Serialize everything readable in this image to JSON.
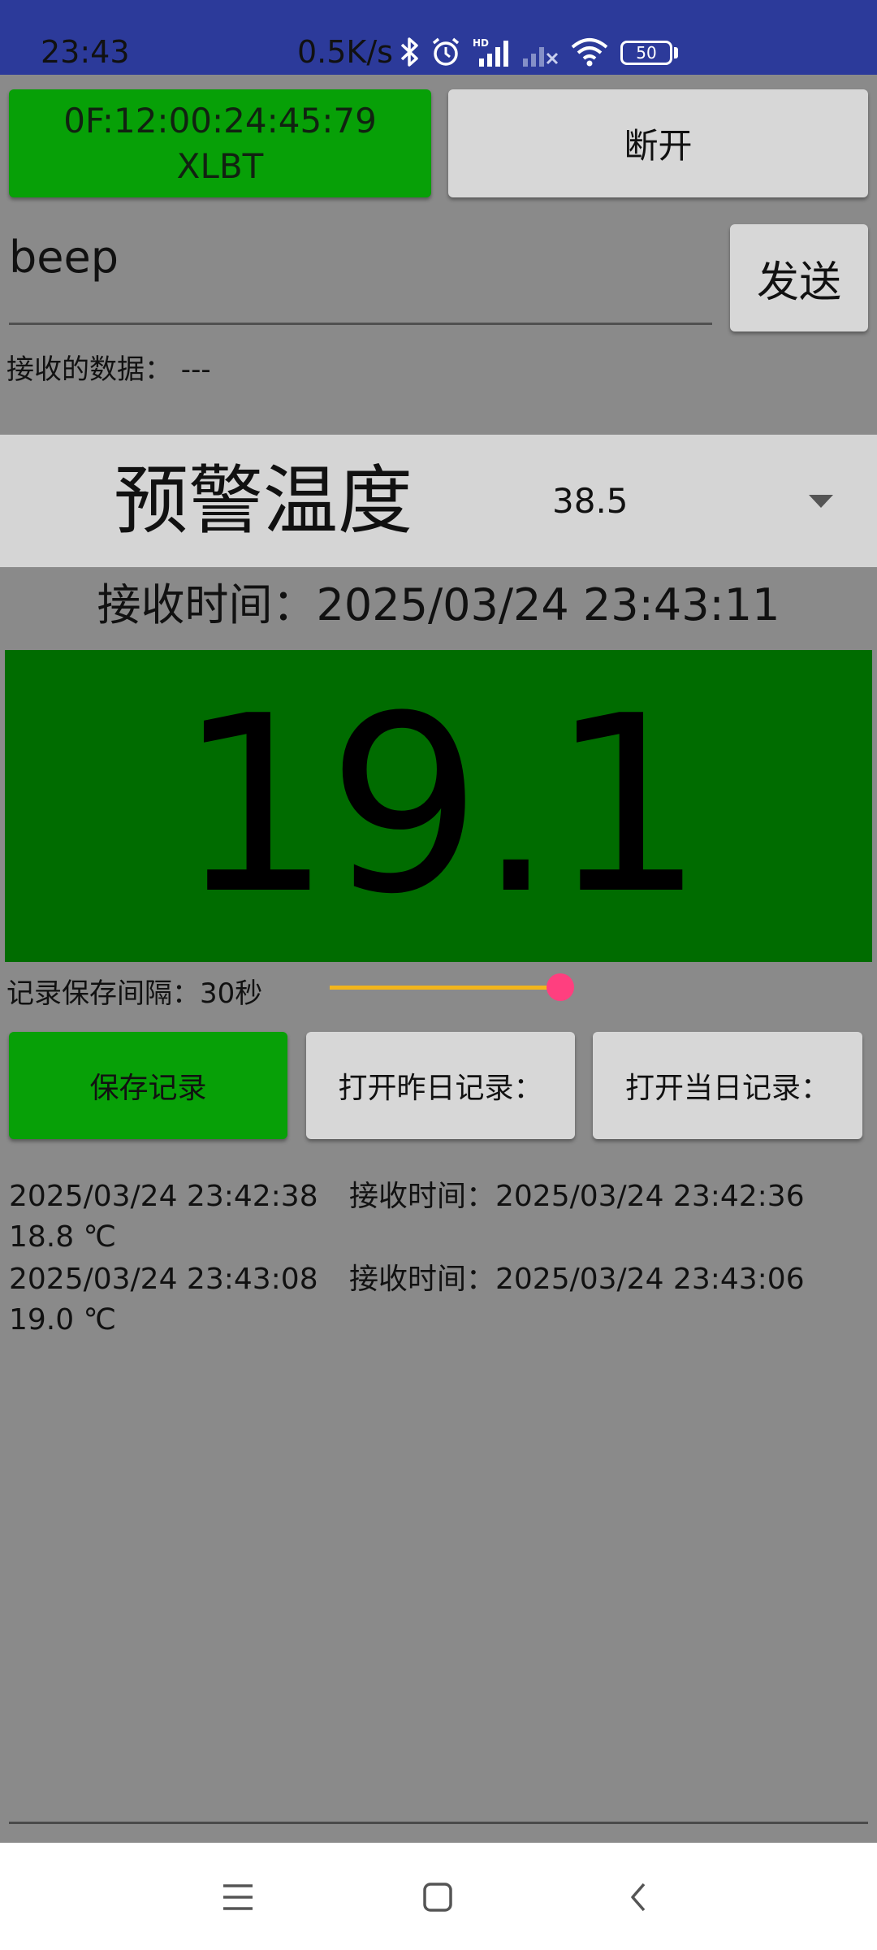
{
  "status_bar": {
    "time": "23:43",
    "speed": "0.5K/s",
    "battery": "50",
    "bar_color": "#2c3a9a",
    "icons": [
      "bluetooth-icon",
      "alarm-icon",
      "hd-signal-icon",
      "no-signal-icon",
      "wifi-icon",
      "battery-icon"
    ]
  },
  "device": {
    "mac": "0F:12:00:24:45:79",
    "name": "XLBT",
    "color": "#07a007"
  },
  "disconnect_label": "断开",
  "command": {
    "value": "beep"
  },
  "send_label": "发送",
  "received": {
    "label": "接收的数据：  ---"
  },
  "warning": {
    "label": "预警温度",
    "selected_value": "38.5"
  },
  "receive_time": "接收时间：2025/03/24 23:43:11",
  "temperature": {
    "value": "19.1",
    "panel_color": "#006c00"
  },
  "interval": {
    "label": "记录保存间隔：30秒",
    "slider_fraction": 1.0,
    "track_color": "#f2b51c",
    "thumb_color": "#ff3f7f"
  },
  "actions": {
    "save": "保存记录",
    "open_yesterday": "打开昨日记录：",
    "open_today": "打开当日记录："
  },
  "records": [
    {
      "saved": "2025/03/24 23:42:38",
      "received": "接收时间：2025/03/24 23:42:36",
      "temp": "18.8 ℃"
    },
    {
      "saved": "2025/03/24 23:43:08",
      "received": "接收时间：2025/03/24 23:43:06",
      "temp": "19.0 ℃"
    }
  ],
  "nav": {
    "icons": [
      "menu-icon",
      "home-icon",
      "back-icon"
    ]
  }
}
